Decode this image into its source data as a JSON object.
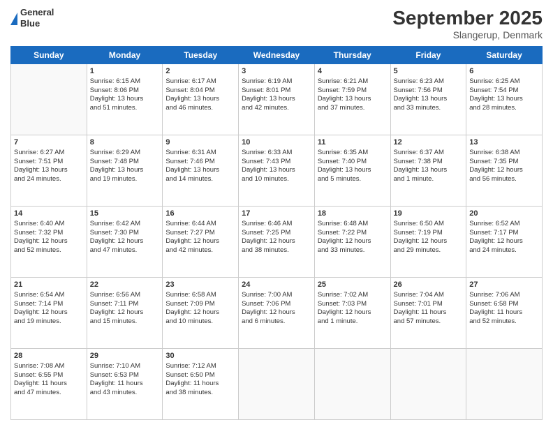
{
  "header": {
    "title": "September 2025",
    "subtitle": "Slangerup, Denmark",
    "logo_line1": "General",
    "logo_line2": "Blue"
  },
  "days_of_week": [
    "Sunday",
    "Monday",
    "Tuesday",
    "Wednesday",
    "Thursday",
    "Friday",
    "Saturday"
  ],
  "weeks": [
    [
      {
        "day": "",
        "content": ""
      },
      {
        "day": "1",
        "content": "Sunrise: 6:15 AM\nSunset: 8:06 PM\nDaylight: 13 hours\nand 51 minutes."
      },
      {
        "day": "2",
        "content": "Sunrise: 6:17 AM\nSunset: 8:04 PM\nDaylight: 13 hours\nand 46 minutes."
      },
      {
        "day": "3",
        "content": "Sunrise: 6:19 AM\nSunset: 8:01 PM\nDaylight: 13 hours\nand 42 minutes."
      },
      {
        "day": "4",
        "content": "Sunrise: 6:21 AM\nSunset: 7:59 PM\nDaylight: 13 hours\nand 37 minutes."
      },
      {
        "day": "5",
        "content": "Sunrise: 6:23 AM\nSunset: 7:56 PM\nDaylight: 13 hours\nand 33 minutes."
      },
      {
        "day": "6",
        "content": "Sunrise: 6:25 AM\nSunset: 7:54 PM\nDaylight: 13 hours\nand 28 minutes."
      }
    ],
    [
      {
        "day": "7",
        "content": "Sunrise: 6:27 AM\nSunset: 7:51 PM\nDaylight: 13 hours\nand 24 minutes."
      },
      {
        "day": "8",
        "content": "Sunrise: 6:29 AM\nSunset: 7:48 PM\nDaylight: 13 hours\nand 19 minutes."
      },
      {
        "day": "9",
        "content": "Sunrise: 6:31 AM\nSunset: 7:46 PM\nDaylight: 13 hours\nand 14 minutes."
      },
      {
        "day": "10",
        "content": "Sunrise: 6:33 AM\nSunset: 7:43 PM\nDaylight: 13 hours\nand 10 minutes."
      },
      {
        "day": "11",
        "content": "Sunrise: 6:35 AM\nSunset: 7:40 PM\nDaylight: 13 hours\nand 5 minutes."
      },
      {
        "day": "12",
        "content": "Sunrise: 6:37 AM\nSunset: 7:38 PM\nDaylight: 13 hours\nand 1 minute."
      },
      {
        "day": "13",
        "content": "Sunrise: 6:38 AM\nSunset: 7:35 PM\nDaylight: 12 hours\nand 56 minutes."
      }
    ],
    [
      {
        "day": "14",
        "content": "Sunrise: 6:40 AM\nSunset: 7:32 PM\nDaylight: 12 hours\nand 52 minutes."
      },
      {
        "day": "15",
        "content": "Sunrise: 6:42 AM\nSunset: 7:30 PM\nDaylight: 12 hours\nand 47 minutes."
      },
      {
        "day": "16",
        "content": "Sunrise: 6:44 AM\nSunset: 7:27 PM\nDaylight: 12 hours\nand 42 minutes."
      },
      {
        "day": "17",
        "content": "Sunrise: 6:46 AM\nSunset: 7:25 PM\nDaylight: 12 hours\nand 38 minutes."
      },
      {
        "day": "18",
        "content": "Sunrise: 6:48 AM\nSunset: 7:22 PM\nDaylight: 12 hours\nand 33 minutes."
      },
      {
        "day": "19",
        "content": "Sunrise: 6:50 AM\nSunset: 7:19 PM\nDaylight: 12 hours\nand 29 minutes."
      },
      {
        "day": "20",
        "content": "Sunrise: 6:52 AM\nSunset: 7:17 PM\nDaylight: 12 hours\nand 24 minutes."
      }
    ],
    [
      {
        "day": "21",
        "content": "Sunrise: 6:54 AM\nSunset: 7:14 PM\nDaylight: 12 hours\nand 19 minutes."
      },
      {
        "day": "22",
        "content": "Sunrise: 6:56 AM\nSunset: 7:11 PM\nDaylight: 12 hours\nand 15 minutes."
      },
      {
        "day": "23",
        "content": "Sunrise: 6:58 AM\nSunset: 7:09 PM\nDaylight: 12 hours\nand 10 minutes."
      },
      {
        "day": "24",
        "content": "Sunrise: 7:00 AM\nSunset: 7:06 PM\nDaylight: 12 hours\nand 6 minutes."
      },
      {
        "day": "25",
        "content": "Sunrise: 7:02 AM\nSunset: 7:03 PM\nDaylight: 12 hours\nand 1 minute."
      },
      {
        "day": "26",
        "content": "Sunrise: 7:04 AM\nSunset: 7:01 PM\nDaylight: 11 hours\nand 57 minutes."
      },
      {
        "day": "27",
        "content": "Sunrise: 7:06 AM\nSunset: 6:58 PM\nDaylight: 11 hours\nand 52 minutes."
      }
    ],
    [
      {
        "day": "28",
        "content": "Sunrise: 7:08 AM\nSunset: 6:55 PM\nDaylight: 11 hours\nand 47 minutes."
      },
      {
        "day": "29",
        "content": "Sunrise: 7:10 AM\nSunset: 6:53 PM\nDaylight: 11 hours\nand 43 minutes."
      },
      {
        "day": "30",
        "content": "Sunrise: 7:12 AM\nSunset: 6:50 PM\nDaylight: 11 hours\nand 38 minutes."
      },
      {
        "day": "",
        "content": ""
      },
      {
        "day": "",
        "content": ""
      },
      {
        "day": "",
        "content": ""
      },
      {
        "day": "",
        "content": ""
      }
    ]
  ]
}
